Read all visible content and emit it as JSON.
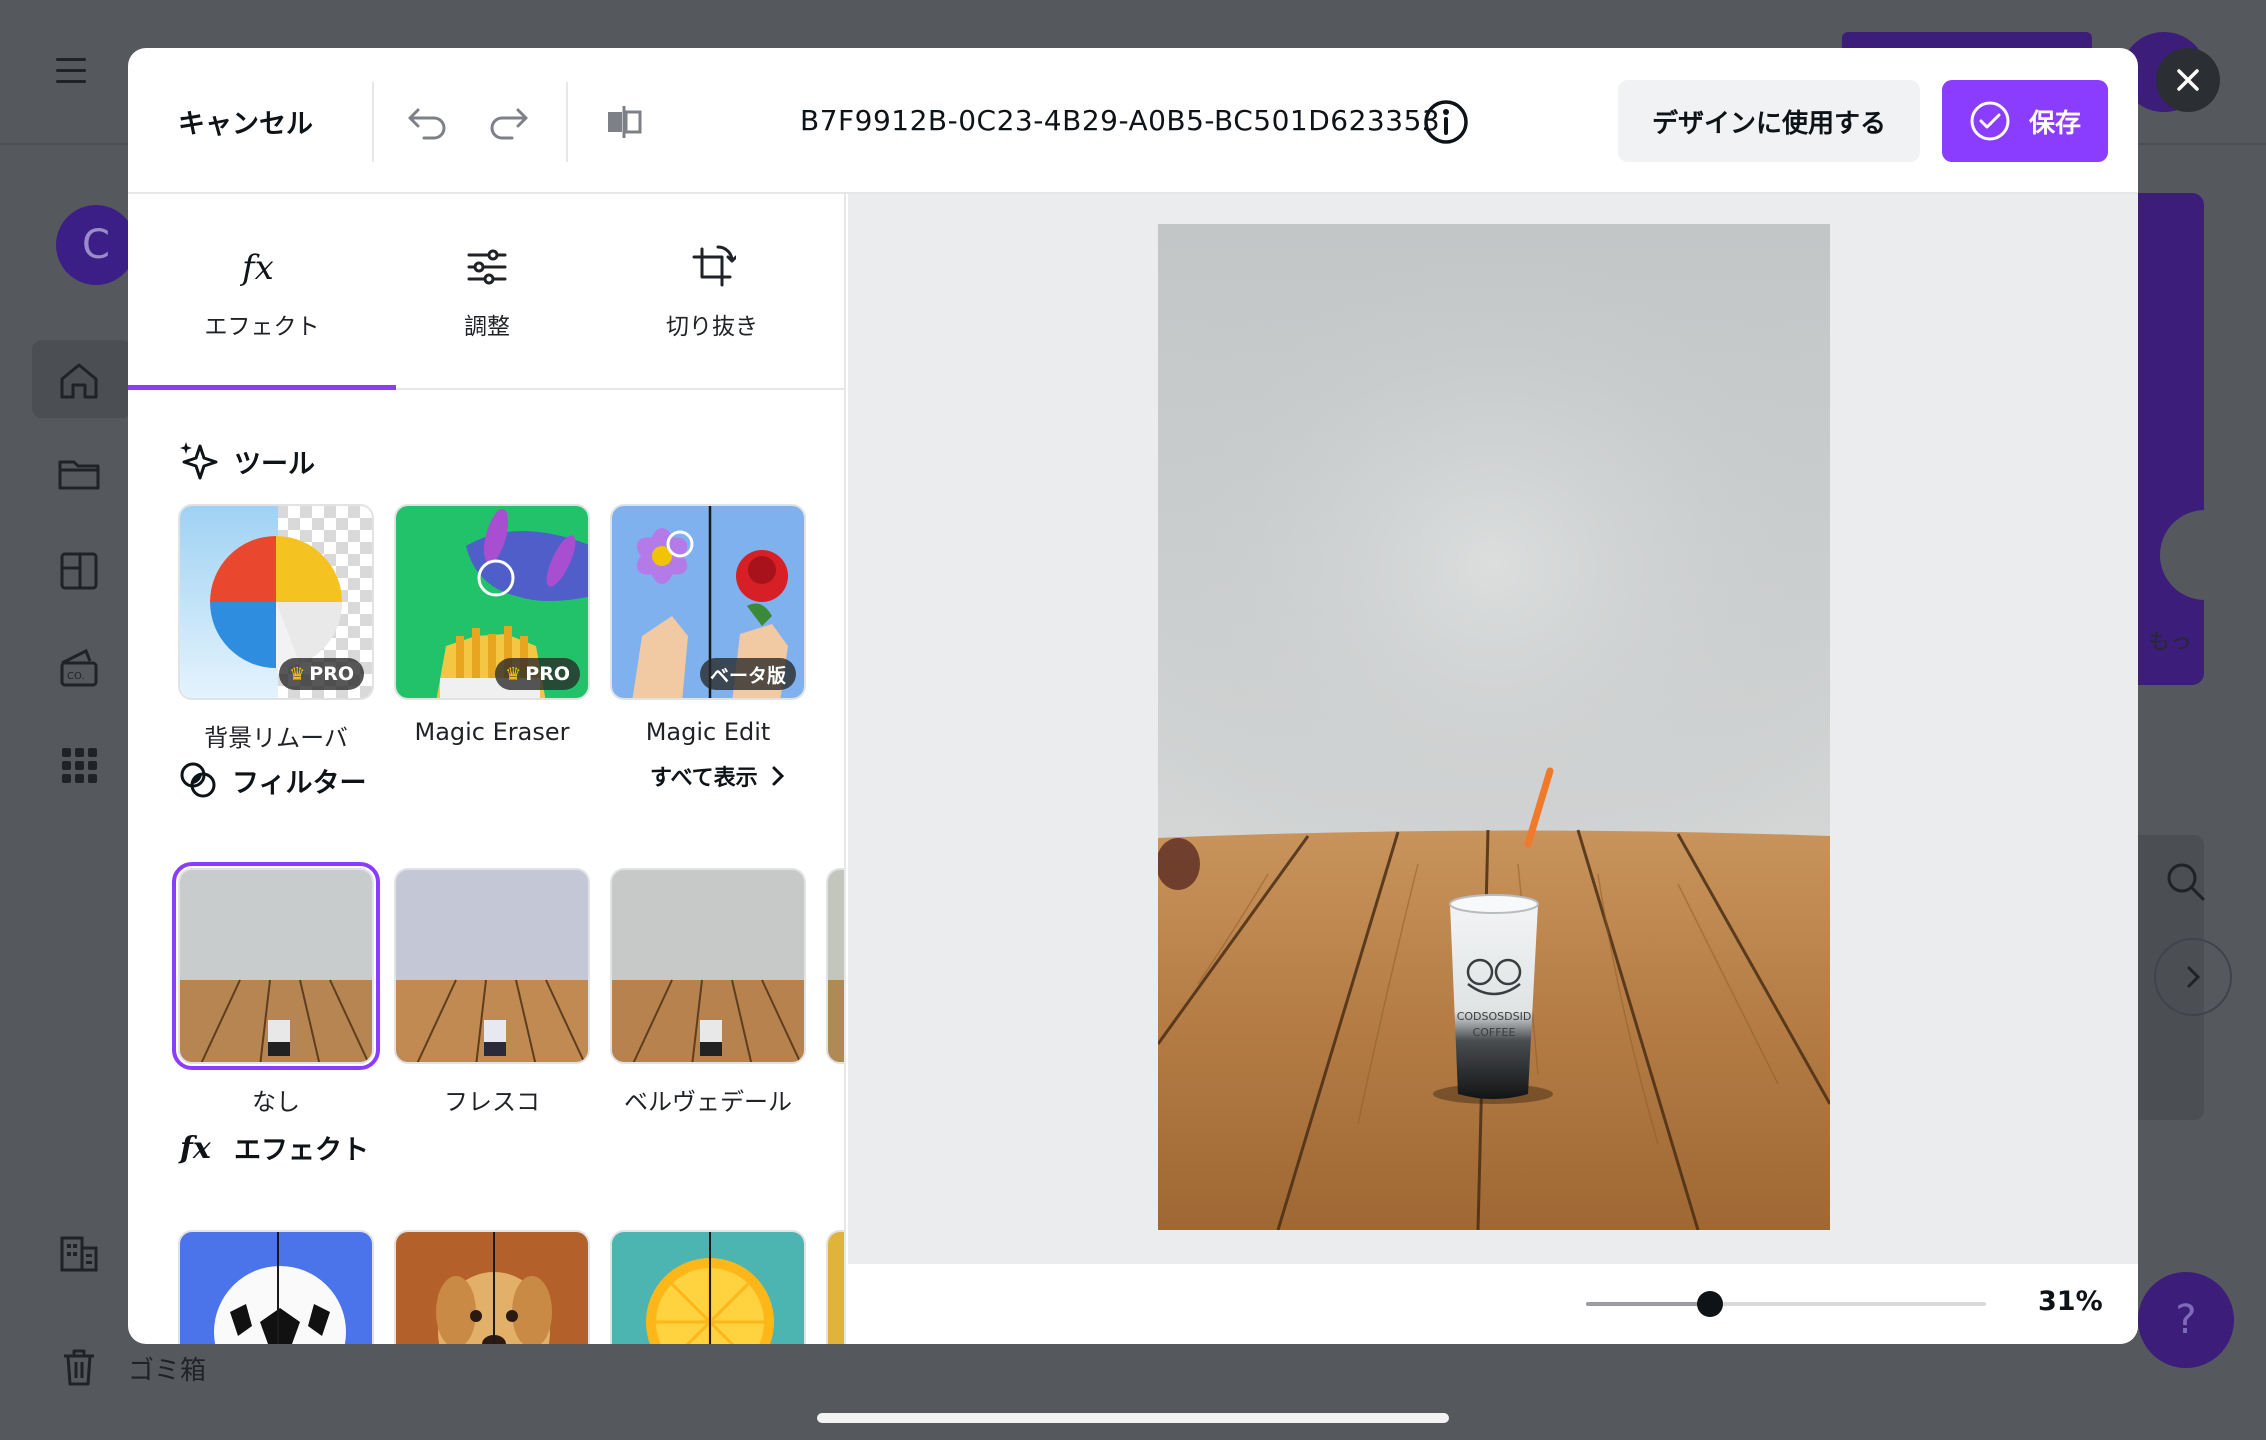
{
  "background": {
    "avatar_letter": "C",
    "trash_label": "ゴミ箱",
    "more_text": "もっ",
    "help_label": "?"
  },
  "header": {
    "cancel_label": "キャンセル",
    "file_name": "B7F9912B-0C23-4B29-A0B5-BC501D623353",
    "use_in_design_label": "デザインに使用する",
    "save_label": "保存"
  },
  "tabs": [
    {
      "label": "エフェクト",
      "icon": "fx-icon",
      "active": true
    },
    {
      "label": "調整",
      "icon": "sliders-icon",
      "active": false
    },
    {
      "label": "切り抜き",
      "icon": "crop-icon",
      "active": false
    }
  ],
  "tools": {
    "title": "ツール",
    "items": [
      {
        "label": "背景リムーバ",
        "badge": "PRO"
      },
      {
        "label": "Magic Eraser",
        "badge": "PRO"
      },
      {
        "label": "Magic Edit",
        "badge": "ベータ版"
      }
    ]
  },
  "filters": {
    "title": "フィルター",
    "see_all_label": "すべて表示",
    "items": [
      {
        "label": "なし",
        "selected": true
      },
      {
        "label": "フレスコ",
        "selected": false
      },
      {
        "label": "ベルヴェデール",
        "selected": false
      }
    ]
  },
  "effects": {
    "title": "エフェクト"
  },
  "zoom": {
    "label": "31%",
    "value": 0.31
  },
  "colors": {
    "accent": "#8b3dff",
    "overlay": "#55595e"
  }
}
